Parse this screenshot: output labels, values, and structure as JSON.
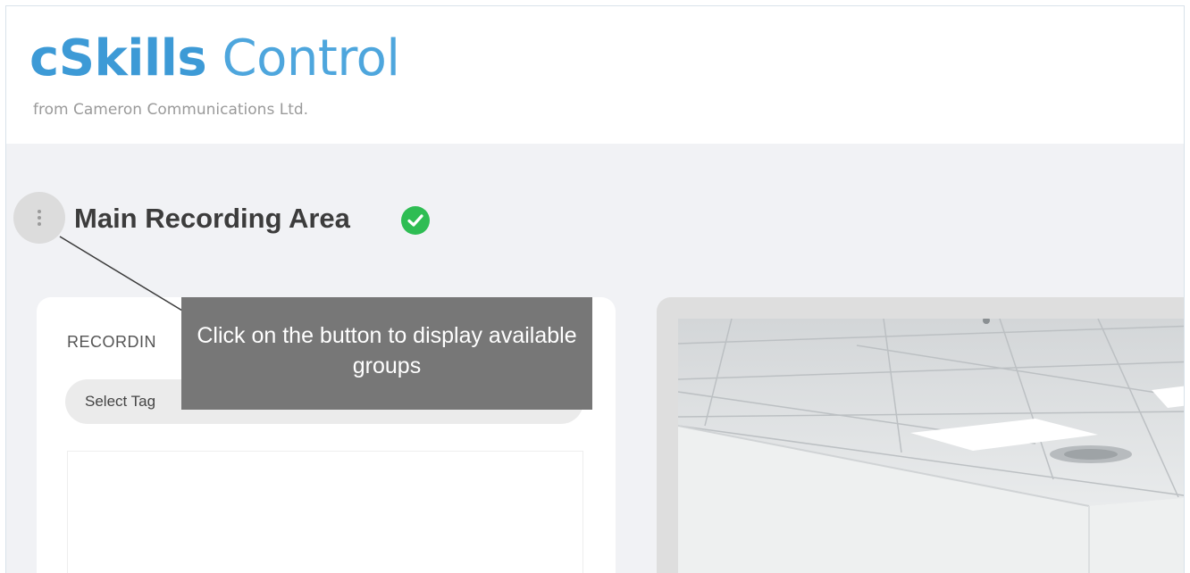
{
  "header": {
    "brand_strong": "cSkills",
    "brand_light": "Control",
    "tagline": "from Cameron Communications Ltd."
  },
  "area": {
    "title": "Main Recording Area",
    "status": "ok",
    "status_color": "#2ebd53"
  },
  "recording_panel": {
    "heading": "RECORDIN",
    "tag_select_text": "Select Tag"
  },
  "tooltip": {
    "text": "Click on the button to display available groups"
  },
  "icons": {
    "menu": "vertical-dots-icon",
    "status": "check-circle-icon"
  },
  "colors": {
    "brand": "#3d9ad6",
    "tooltip_bg": "#777777",
    "page_bg": "#f1f2f5"
  }
}
